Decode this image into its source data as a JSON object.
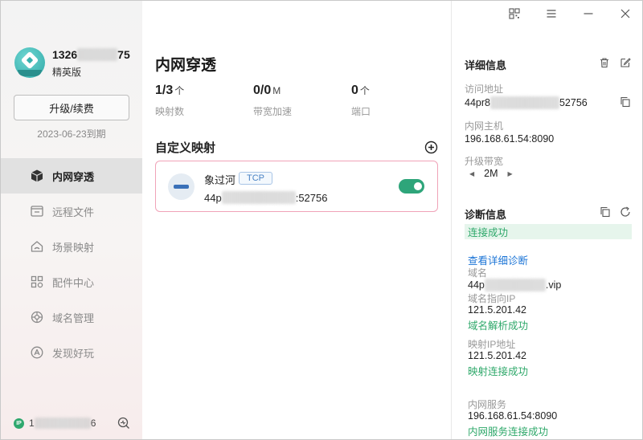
{
  "user": {
    "phone_prefix": "1326",
    "phone_suffix": "75",
    "edition": "精英版",
    "renew_label": "升级/续费",
    "expire": "2023-06-23到期"
  },
  "nav": [
    {
      "label": "内网穿透",
      "icon": "cube-icon",
      "active": true
    },
    {
      "label": "远程文件",
      "icon": "folder-icon",
      "active": false
    },
    {
      "label": "场景映射",
      "icon": "home-icon",
      "active": false
    },
    {
      "label": "配件中心",
      "icon": "grid-icon",
      "active": false
    },
    {
      "label": "域名管理",
      "icon": "domain-icon",
      "active": false
    },
    {
      "label": "发现好玩",
      "icon": "discover-icon",
      "active": false
    }
  ],
  "footer": {
    "ip_badge": "IP",
    "ip_prefix": "1",
    "ip_suffix": "6"
  },
  "main": {
    "title": "内网穿透",
    "stats": [
      {
        "value": "1/3",
        "unit": "个",
        "label": "映射数"
      },
      {
        "value": "0/0",
        "unit": "M",
        "label": "带宽加速"
      },
      {
        "value": "0",
        "unit": "个",
        "label": "端口"
      }
    ],
    "section_title": "自定义映射",
    "mapping": {
      "name": "象过河",
      "protocol": "TCP",
      "addr_prefix": "44p",
      "addr_suffix": ":52756",
      "enabled": true
    }
  },
  "details": {
    "title": "详细信息",
    "access_label": "访问地址",
    "access_prefix": "44pr8",
    "access_suffix": "52756",
    "host_label": "内网主机",
    "host_value": "196.168.61.54:8090",
    "bandwidth_label": "升级带宽",
    "bandwidth_value": "2M"
  },
  "diagnosis": {
    "title": "诊断信息",
    "status": "连接成功",
    "detail_link": "查看详细诊断",
    "domain_label": "域名",
    "domain_prefix": "44p",
    "domain_suffix": ".vip",
    "domain_ip_label": "域名指向IP",
    "domain_ip_value": "121.5.201.42",
    "domain_ok": "域名解析成功",
    "map_ip_label": "映射IP地址",
    "map_ip_value": "121.5.201.42",
    "map_ok": "映射连接成功",
    "service_label": "内网服务",
    "service_value": "196.168.61.54:8090",
    "service_ok": "内网服务连接成功"
  },
  "colors": {
    "accent_green": "#2ea57a",
    "link_blue": "#1b74d6",
    "card_border": "#f0a3b8"
  }
}
